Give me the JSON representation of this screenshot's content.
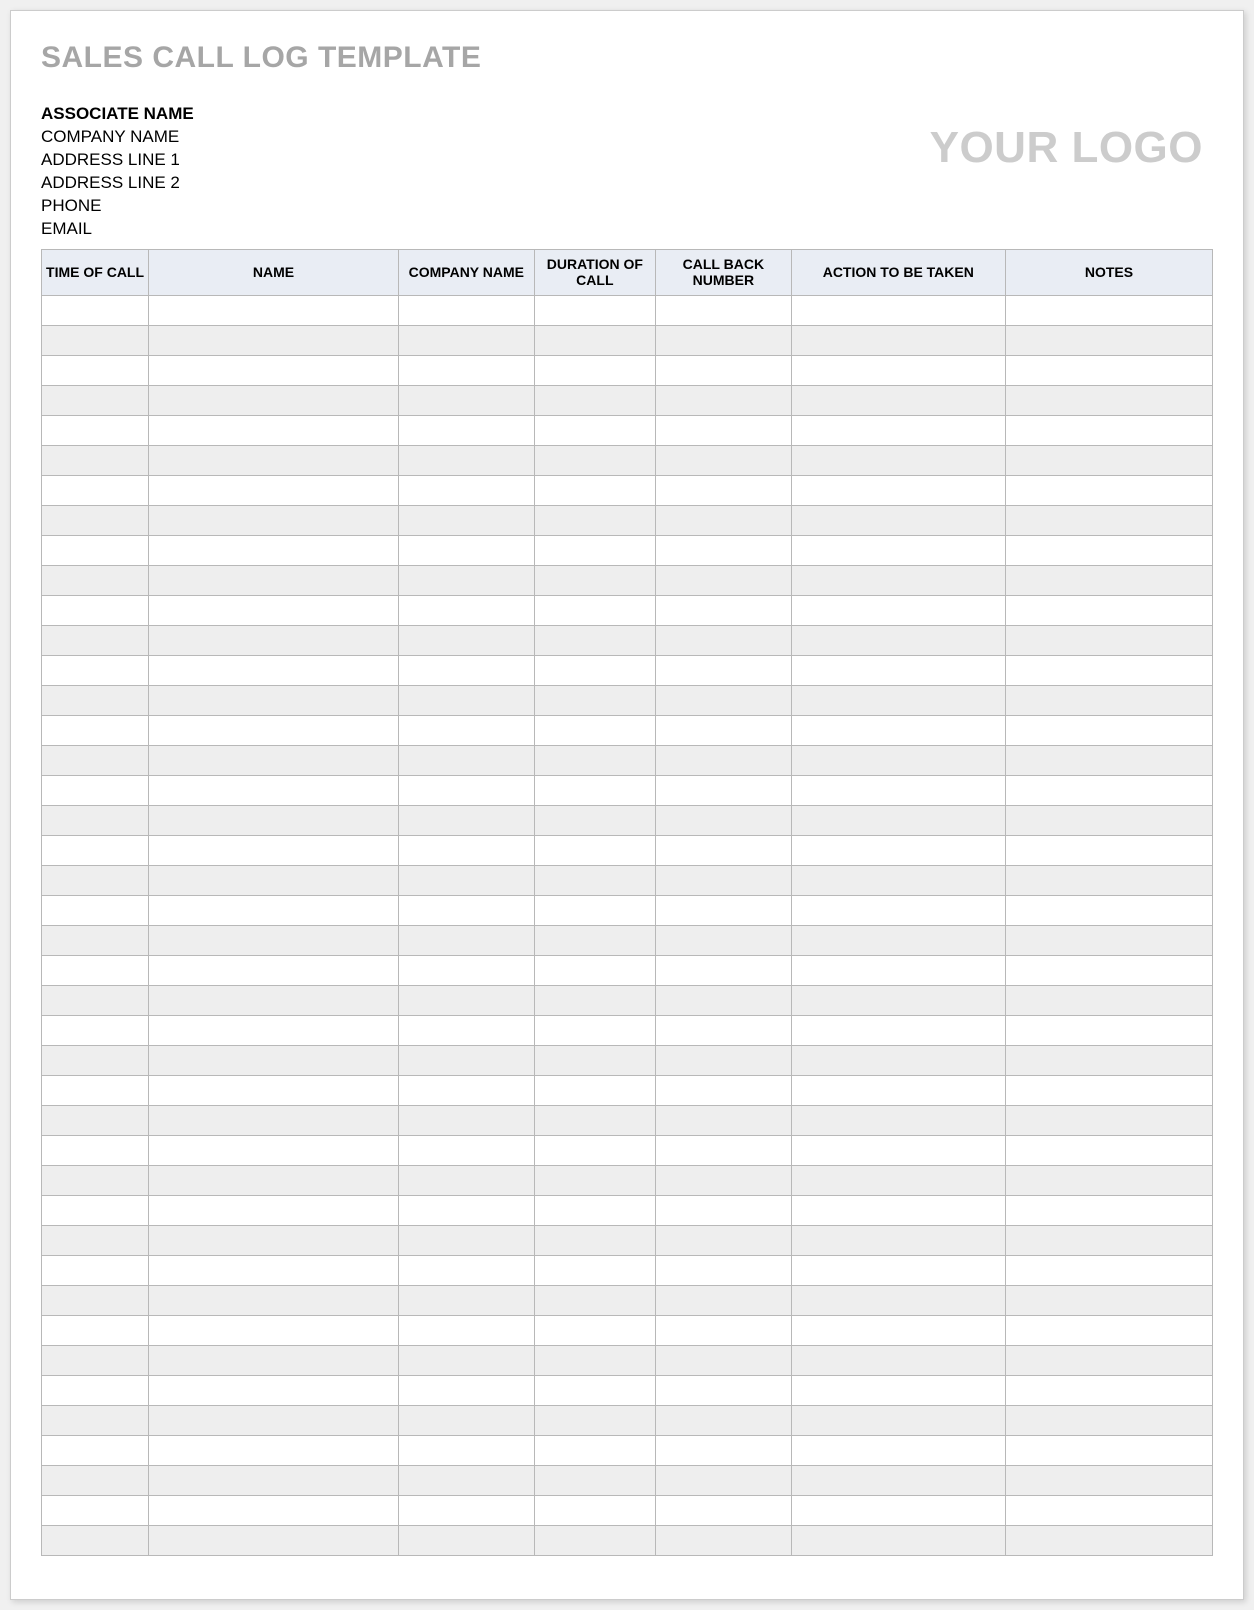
{
  "title": "SALES CALL LOG TEMPLATE",
  "logo_text": "YOUR LOGO",
  "associate": {
    "name_label": "ASSOCIATE NAME",
    "company_label": "COMPANY NAME",
    "address1_label": "ADDRESS LINE 1",
    "address2_label": "ADDRESS LINE 2",
    "phone_label": "PHONE",
    "email_label": "EMAIL"
  },
  "columns": {
    "time_of_call": "TIME OF CALL",
    "name": "NAME",
    "company_name": "COMPANY NAME",
    "duration_of_call": "DURATION OF CALL",
    "call_back_number": "CALL BACK NUMBER",
    "action_to_be_taken": "ACTION TO BE TAKEN",
    "notes": "NOTES"
  },
  "rows": [
    {
      "time": "",
      "name": "",
      "company": "",
      "duration": "",
      "callback": "",
      "action": "",
      "notes": ""
    },
    {
      "time": "",
      "name": "",
      "company": "",
      "duration": "",
      "callback": "",
      "action": "",
      "notes": ""
    },
    {
      "time": "",
      "name": "",
      "company": "",
      "duration": "",
      "callback": "",
      "action": "",
      "notes": ""
    },
    {
      "time": "",
      "name": "",
      "company": "",
      "duration": "",
      "callback": "",
      "action": "",
      "notes": ""
    },
    {
      "time": "",
      "name": "",
      "company": "",
      "duration": "",
      "callback": "",
      "action": "",
      "notes": ""
    },
    {
      "time": "",
      "name": "",
      "company": "",
      "duration": "",
      "callback": "",
      "action": "",
      "notes": ""
    },
    {
      "time": "",
      "name": "",
      "company": "",
      "duration": "",
      "callback": "",
      "action": "",
      "notes": ""
    },
    {
      "time": "",
      "name": "",
      "company": "",
      "duration": "",
      "callback": "",
      "action": "",
      "notes": ""
    },
    {
      "time": "",
      "name": "",
      "company": "",
      "duration": "",
      "callback": "",
      "action": "",
      "notes": ""
    },
    {
      "time": "",
      "name": "",
      "company": "",
      "duration": "",
      "callback": "",
      "action": "",
      "notes": ""
    },
    {
      "time": "",
      "name": "",
      "company": "",
      "duration": "",
      "callback": "",
      "action": "",
      "notes": ""
    },
    {
      "time": "",
      "name": "",
      "company": "",
      "duration": "",
      "callback": "",
      "action": "",
      "notes": ""
    },
    {
      "time": "",
      "name": "",
      "company": "",
      "duration": "",
      "callback": "",
      "action": "",
      "notes": ""
    },
    {
      "time": "",
      "name": "",
      "company": "",
      "duration": "",
      "callback": "",
      "action": "",
      "notes": ""
    },
    {
      "time": "",
      "name": "",
      "company": "",
      "duration": "",
      "callback": "",
      "action": "",
      "notes": ""
    },
    {
      "time": "",
      "name": "",
      "company": "",
      "duration": "",
      "callback": "",
      "action": "",
      "notes": ""
    },
    {
      "time": "",
      "name": "",
      "company": "",
      "duration": "",
      "callback": "",
      "action": "",
      "notes": ""
    },
    {
      "time": "",
      "name": "",
      "company": "",
      "duration": "",
      "callback": "",
      "action": "",
      "notes": ""
    },
    {
      "time": "",
      "name": "",
      "company": "",
      "duration": "",
      "callback": "",
      "action": "",
      "notes": ""
    },
    {
      "time": "",
      "name": "",
      "company": "",
      "duration": "",
      "callback": "",
      "action": "",
      "notes": ""
    },
    {
      "time": "",
      "name": "",
      "company": "",
      "duration": "",
      "callback": "",
      "action": "",
      "notes": ""
    },
    {
      "time": "",
      "name": "",
      "company": "",
      "duration": "",
      "callback": "",
      "action": "",
      "notes": ""
    },
    {
      "time": "",
      "name": "",
      "company": "",
      "duration": "",
      "callback": "",
      "action": "",
      "notes": ""
    },
    {
      "time": "",
      "name": "",
      "company": "",
      "duration": "",
      "callback": "",
      "action": "",
      "notes": ""
    },
    {
      "time": "",
      "name": "",
      "company": "",
      "duration": "",
      "callback": "",
      "action": "",
      "notes": ""
    },
    {
      "time": "",
      "name": "",
      "company": "",
      "duration": "",
      "callback": "",
      "action": "",
      "notes": ""
    },
    {
      "time": "",
      "name": "",
      "company": "",
      "duration": "",
      "callback": "",
      "action": "",
      "notes": ""
    },
    {
      "time": "",
      "name": "",
      "company": "",
      "duration": "",
      "callback": "",
      "action": "",
      "notes": ""
    },
    {
      "time": "",
      "name": "",
      "company": "",
      "duration": "",
      "callback": "",
      "action": "",
      "notes": ""
    },
    {
      "time": "",
      "name": "",
      "company": "",
      "duration": "",
      "callback": "",
      "action": "",
      "notes": ""
    },
    {
      "time": "",
      "name": "",
      "company": "",
      "duration": "",
      "callback": "",
      "action": "",
      "notes": ""
    },
    {
      "time": "",
      "name": "",
      "company": "",
      "duration": "",
      "callback": "",
      "action": "",
      "notes": ""
    },
    {
      "time": "",
      "name": "",
      "company": "",
      "duration": "",
      "callback": "",
      "action": "",
      "notes": ""
    },
    {
      "time": "",
      "name": "",
      "company": "",
      "duration": "",
      "callback": "",
      "action": "",
      "notes": ""
    },
    {
      "time": "",
      "name": "",
      "company": "",
      "duration": "",
      "callback": "",
      "action": "",
      "notes": ""
    },
    {
      "time": "",
      "name": "",
      "company": "",
      "duration": "",
      "callback": "",
      "action": "",
      "notes": ""
    },
    {
      "time": "",
      "name": "",
      "company": "",
      "duration": "",
      "callback": "",
      "action": "",
      "notes": ""
    },
    {
      "time": "",
      "name": "",
      "company": "",
      "duration": "",
      "callback": "",
      "action": "",
      "notes": ""
    },
    {
      "time": "",
      "name": "",
      "company": "",
      "duration": "",
      "callback": "",
      "action": "",
      "notes": ""
    },
    {
      "time": "",
      "name": "",
      "company": "",
      "duration": "",
      "callback": "",
      "action": "",
      "notes": ""
    },
    {
      "time": "",
      "name": "",
      "company": "",
      "duration": "",
      "callback": "",
      "action": "",
      "notes": ""
    },
    {
      "time": "",
      "name": "",
      "company": "",
      "duration": "",
      "callback": "",
      "action": "",
      "notes": ""
    }
  ]
}
